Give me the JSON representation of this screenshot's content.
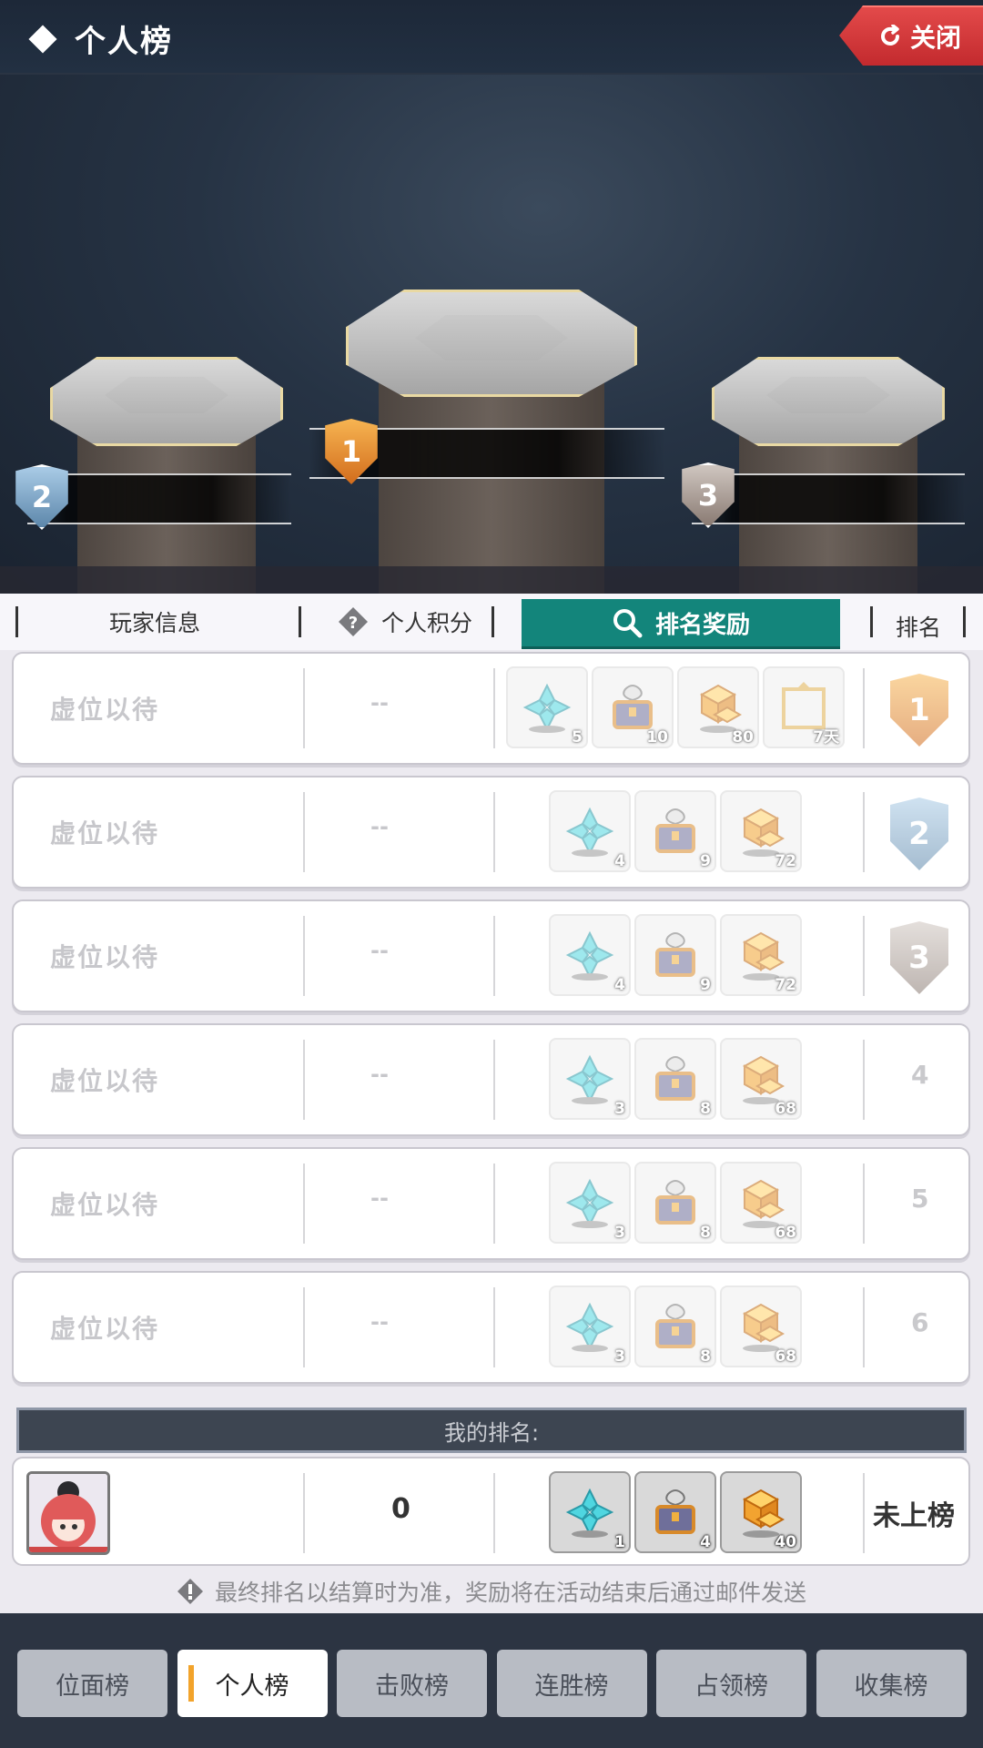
{
  "header": {
    "title": "个人榜",
    "close_label": "关闭"
  },
  "columns": {
    "player_info": "玩家信息",
    "score": "个人积分",
    "reward": "排名奖励",
    "rank": "排名"
  },
  "rows": [
    {
      "name": "虚位以待",
      "score": "--",
      "rank": "1",
      "rank_type": "medal-gold",
      "rewards": [
        {
          "icon": "crystal-icon",
          "qty": "5"
        },
        {
          "icon": "chest-icon",
          "qty": "10"
        },
        {
          "icon": "cube-icon",
          "qty": "80"
        },
        {
          "icon": "frame-icon",
          "qty": "7天"
        }
      ]
    },
    {
      "name": "虚位以待",
      "score": "--",
      "rank": "2",
      "rank_type": "medal-silver",
      "rewards": [
        {
          "icon": "crystal-icon",
          "qty": "4"
        },
        {
          "icon": "chest-icon",
          "qty": "9"
        },
        {
          "icon": "cube-icon",
          "qty": "72"
        }
      ]
    },
    {
      "name": "虚位以待",
      "score": "--",
      "rank": "3",
      "rank_type": "medal-bronze",
      "rewards": [
        {
          "icon": "crystal-icon",
          "qty": "4"
        },
        {
          "icon": "chest-icon",
          "qty": "9"
        },
        {
          "icon": "cube-icon",
          "qty": "72"
        }
      ]
    },
    {
      "name": "虚位以待",
      "score": "--",
      "rank": "4",
      "rank_type": "number",
      "rewards": [
        {
          "icon": "crystal-icon",
          "qty": "3"
        },
        {
          "icon": "chest-icon",
          "qty": "8"
        },
        {
          "icon": "cube-icon",
          "qty": "68"
        }
      ]
    },
    {
      "name": "虚位以待",
      "score": "--",
      "rank": "5",
      "rank_type": "number",
      "rewards": [
        {
          "icon": "crystal-icon",
          "qty": "3"
        },
        {
          "icon": "chest-icon",
          "qty": "8"
        },
        {
          "icon": "cube-icon",
          "qty": "68"
        }
      ]
    },
    {
      "name": "虚位以待",
      "score": "--",
      "rank": "6",
      "rank_type": "number",
      "rewards": [
        {
          "icon": "crystal-icon",
          "qty": "3"
        },
        {
          "icon": "chest-icon",
          "qty": "8"
        },
        {
          "icon": "cube-icon",
          "qty": "68"
        }
      ]
    }
  ],
  "my_rank": {
    "label": "我的排名:",
    "score": "0",
    "status": "未上榜",
    "rewards": [
      {
        "icon": "crystal-icon",
        "qty": "1"
      },
      {
        "icon": "chest-icon",
        "qty": "4"
      },
      {
        "icon": "cube-icon",
        "qty": "40"
      }
    ]
  },
  "notice": "最终排名以结算时为准，奖励将在活动结束后通过邮件发送",
  "bottom_tabs": [
    {
      "label": "位面榜",
      "active": false
    },
    {
      "label": "个人榜",
      "active": true
    },
    {
      "label": "击败榜",
      "active": false
    },
    {
      "label": "连胜榜",
      "active": false
    },
    {
      "label": "占领榜",
      "active": false
    },
    {
      "label": "收集榜",
      "active": false
    }
  ],
  "podium": {
    "first": "1",
    "second": "2",
    "third": "3"
  },
  "colors": {
    "accent_teal": "#13857b",
    "close_red": "#d63a3c",
    "tab_active_bar": "#f2a32b",
    "gold": "#e08a2a",
    "silver": "#7ea9c9",
    "bronze": "#a89a94"
  }
}
